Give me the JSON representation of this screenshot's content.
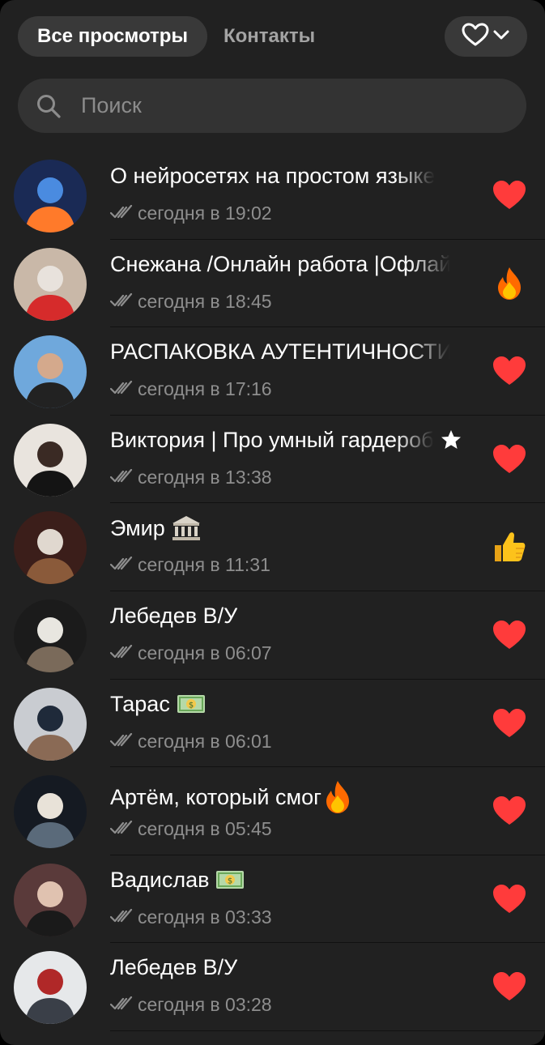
{
  "tabs": [
    {
      "label": "Все просмотры",
      "active": true
    },
    {
      "label": "Контакты",
      "active": false
    }
  ],
  "filter": {
    "icon": "heart-outline-icon",
    "chevron": "chevron-down-icon"
  },
  "search": {
    "placeholder": "Поиск",
    "value": ""
  },
  "colors": {
    "background": "#212121",
    "heart": "#ff3b3b",
    "muted": "#8e8e8e"
  },
  "viewers": [
    {
      "name": "О нейросетях на простом языке",
      "time": "сегодня в 19:02",
      "reaction": "heart",
      "suffix": ""
    },
    {
      "name": "Снежана /Онлайн работа |Офлайн",
      "time": "сегодня в 18:45",
      "reaction": "fire",
      "suffix": ""
    },
    {
      "name": "РАСПАКОВКА АУТЕНТИЧНОСТИ",
      "time": "сегодня в 17:16",
      "reaction": "heart",
      "suffix": ""
    },
    {
      "name": "Виктория | Про умный гардероб",
      "time": "сегодня в 13:38",
      "reaction": "heart",
      "suffix": "star"
    },
    {
      "name": "Эмир",
      "time": "сегодня в 11:31",
      "reaction": "thumbs-up",
      "suffix": "bank"
    },
    {
      "name": "Лебедев В/У",
      "time": "сегодня в 06:07",
      "reaction": "heart",
      "suffix": ""
    },
    {
      "name": "Тарас",
      "time": "сегодня в 06:01",
      "reaction": "heart",
      "suffix": "money"
    },
    {
      "name": "Артём, который смог",
      "time": "сегодня в 05:45",
      "reaction": "heart",
      "suffix": "fire"
    },
    {
      "name": "Вадислав",
      "time": "сегодня в 03:33",
      "reaction": "heart",
      "suffix": "money"
    },
    {
      "name": "Лебедев В/У",
      "time": "сегодня в 03:28",
      "reaction": "heart",
      "suffix": ""
    }
  ]
}
